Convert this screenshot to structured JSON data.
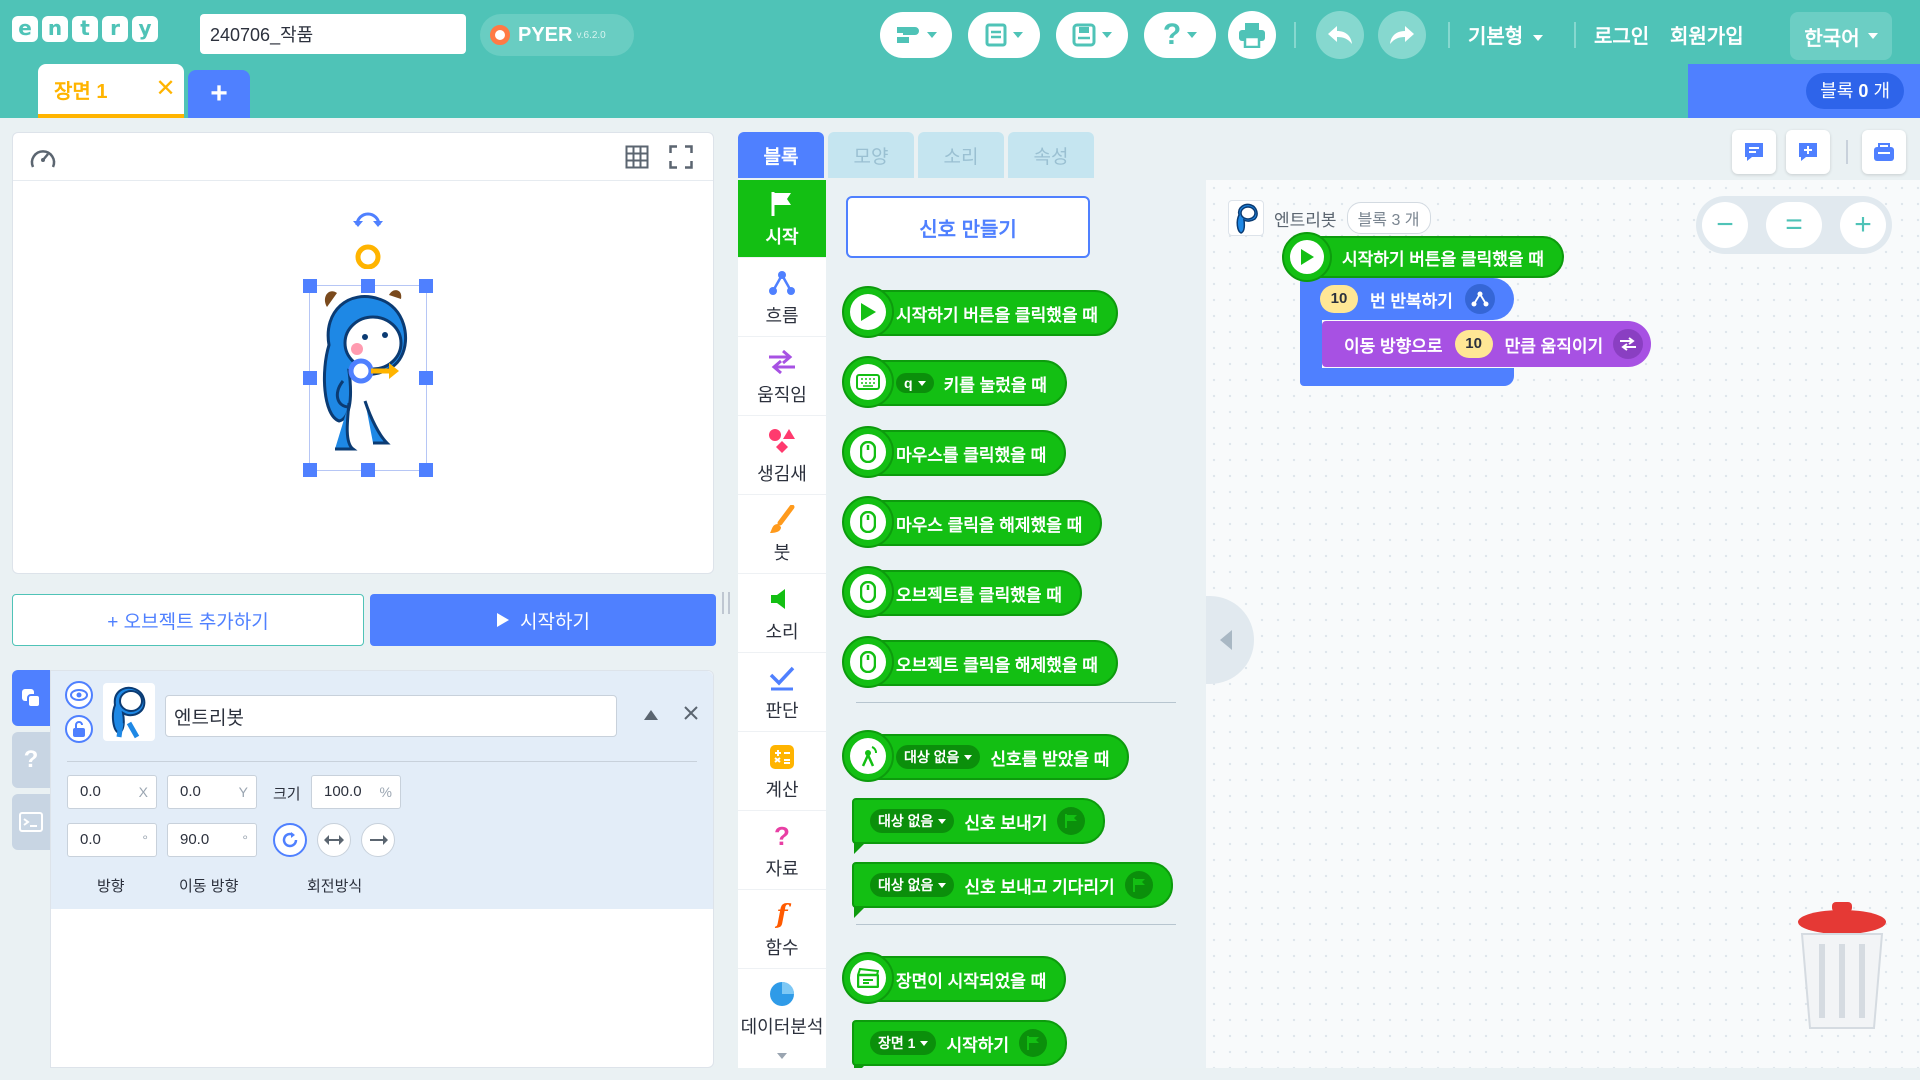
{
  "header": {
    "logo_letters": [
      "e",
      "n",
      "t",
      "r",
      "y"
    ],
    "project_name": "240706_작품",
    "pyer_name": "PYER",
    "pyer_version": "v.6.2.0",
    "mode_label": "기본형",
    "login_label": "로그인",
    "signup_label": "회원가입",
    "language_label": "한국어"
  },
  "scene": {
    "tab_label": "장면 1",
    "close_glyph": "✕",
    "add_glyph": "+"
  },
  "block_count": {
    "prefix": "블록",
    "count": "0",
    "suffix": "개"
  },
  "stage": {
    "add_object_label": "+ 오브젝트 추가하기",
    "start_label": "시작하기"
  },
  "object": {
    "name": "엔트리봇",
    "x": "0.0",
    "x_unit": "X",
    "y": "0.0",
    "y_unit": "Y",
    "size_label": "크기",
    "size": "100.0",
    "size_unit": "%",
    "direction": "0.0",
    "move_direction": "90.0",
    "degree_unit": "°",
    "direction_label": "방향",
    "move_direction_label": "이동 방향",
    "rotation_label": "회전방식"
  },
  "palette_tabs": [
    "블록",
    "모양",
    "소리",
    "속성"
  ],
  "categories": [
    "시작",
    "흐름",
    "움직임",
    "생김새",
    "붓",
    "소리",
    "판단",
    "계산",
    "자료",
    "함수",
    "데이터분석"
  ],
  "palette": {
    "make_signal": "신호 만들기",
    "when_start_clicked": "시작하기 버튼을 클릭했을 때",
    "key_dropdown": "q",
    "when_key_pressed": "키를 눌렀을 때",
    "when_mouse_clicked": "마우스를 클릭했을 때",
    "when_mouse_released": "마우스 클릭을 해제했을 때",
    "when_object_clicked": "오브젝트를 클릭했을 때",
    "when_object_released": "오브젝트 클릭을 해제했을 때",
    "no_target": "대상 없음",
    "when_signal_received": "신호를 받았을 때",
    "send_signal": "신호 보내기",
    "send_signal_wait": "신호 보내고 기다리기",
    "when_scene_started": "장면이 시작되었을 때",
    "scene_dropdown": "장면 1",
    "start_scene": "시작하기"
  },
  "workspace": {
    "object_name": "엔트리봇",
    "block_count_label": "블록 3 개",
    "hat_label": "시작하기 버튼을 클릭했을 때",
    "repeat_count": "10",
    "repeat_label": "번 반복하기",
    "move_prefix": "이동 방향으로",
    "move_amount": "10",
    "move_suffix": "만큼 움직이기",
    "zoom_out": "−",
    "zoom_reset": "=",
    "zoom_in": "+"
  },
  "colors": {
    "header": "#4fc3b7",
    "accent_blue": "#4f80ff",
    "start_green": "#13bf13",
    "flow_blue": "#4f80ff",
    "move_purple": "#a751e3",
    "scene_orange": "#ffb400"
  }
}
